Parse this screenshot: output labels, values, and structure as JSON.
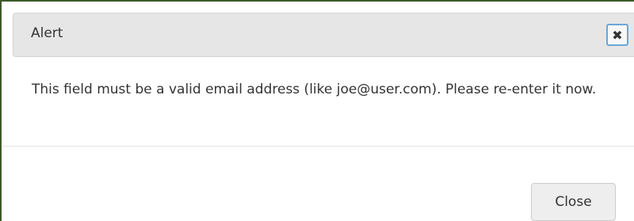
{
  "dialog": {
    "title": "Alert",
    "close_icon": "close-icon",
    "close_glyph": "✖",
    "message": "This field must be a valid email address (like joe@user.com). Please re-enter it now.",
    "close_button_label": "Close"
  },
  "colors": {
    "titlebar_bg": "#e6e6e6",
    "close_icon_border": "#6aa6d8",
    "text": "#333333",
    "button_bg": "#eeeeee"
  }
}
